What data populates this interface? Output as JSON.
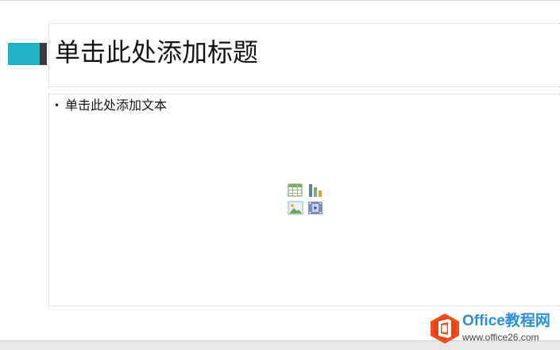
{
  "slide": {
    "title_placeholder": "单击此处添加标题",
    "content_placeholder": "单击此处添加文本",
    "bullet": "•"
  },
  "insert_icons": [
    "table-icon",
    "chart-icon",
    "picture-icon",
    "video-icon"
  ],
  "colors": {
    "accent_teal": "#1fb2c8",
    "accent_dark": "#3b3b3b",
    "watermark_blue": "#2a8fd6",
    "watermark_orange": "#f0501e"
  },
  "watermark": {
    "name": "Office教程网",
    "url": "www.office26.com"
  }
}
